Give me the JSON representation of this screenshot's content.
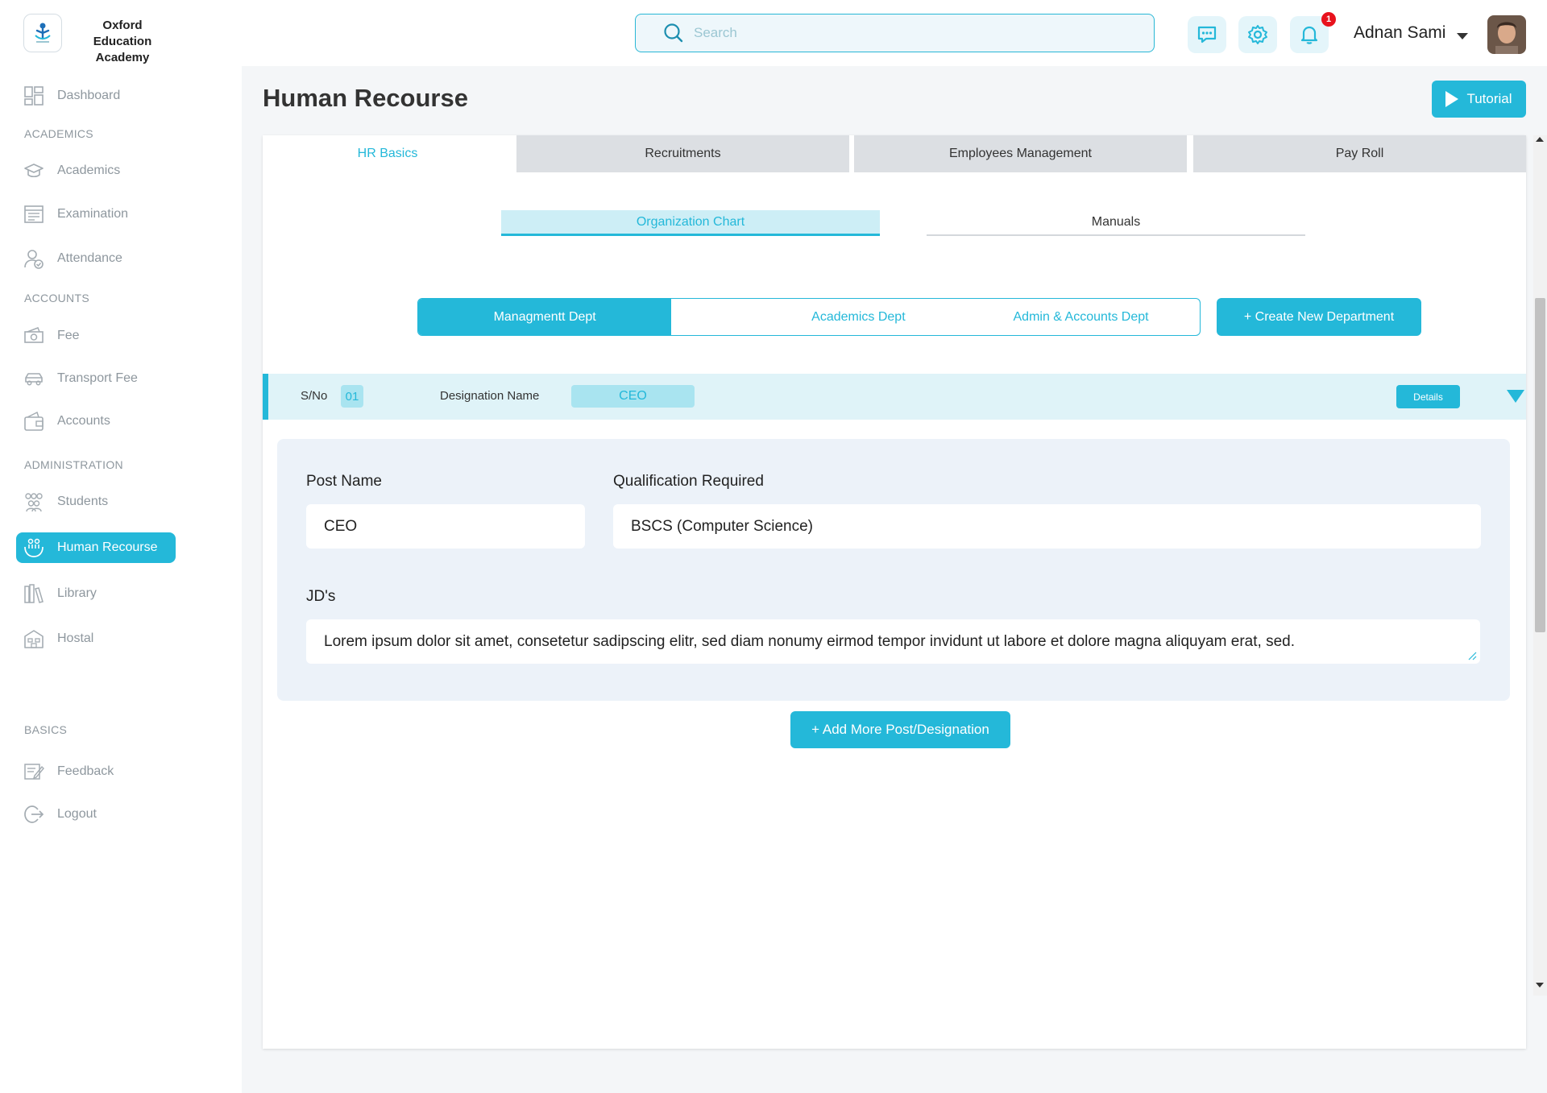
{
  "header": {
    "school_name": "Oxford Education Academy",
    "search_placeholder": "Search",
    "notification_count": "1",
    "user_name": "Adnan Sami"
  },
  "sidebar": {
    "dashboard": "Dashboard",
    "section_academics": "ACADEMICS",
    "academics": "Academics",
    "examination": "Examination",
    "attendance": "Attendance",
    "section_accounts": "ACCOUNTS",
    "fee": "Fee",
    "transport_fee": "Transport Fee",
    "accounts": "Accounts",
    "section_administration": "ADMINISTRATION",
    "students": "Students",
    "human_recourse": "Human Recourse",
    "library": "Library",
    "hostal": "Hostal",
    "section_basics": "BASICS",
    "feedback": "Feedback",
    "logout": "Logout"
  },
  "page": {
    "title": "Human Recourse",
    "tutorial_label": "Tutorial"
  },
  "tabs": {
    "hr_basics": "HR Basics",
    "recruitments": "Recruitments",
    "employees_management": "Employees Management",
    "pay_roll": "Pay Roll"
  },
  "subtabs": {
    "organization_chart": "Organization Chart",
    "manuals": "Manuals"
  },
  "departments": {
    "management": "Managmentt Dept",
    "academics": "Academics Dept",
    "admin_accounts": "Admin & Accounts Dept",
    "create_label": "+ Create New Department"
  },
  "designation_row": {
    "sno_label": "S/No",
    "sno_value": "01",
    "designation_label": "Designation Name",
    "designation_value": "CEO",
    "details_label": "Details"
  },
  "detail": {
    "post_name_label": "Post Name",
    "post_name_value": "CEO",
    "qualification_label": "Qualification Required",
    "qualification_value": "BSCS (Computer Science)",
    "jds_label": "JD's",
    "jds_value": "Lorem ipsum dolor sit amet, consetetur sadipscing elitr, sed diam nonumy eirmod tempor invidunt ut labore et dolore magna aliquyam erat, sed.",
    "add_more_label": "+ Add More Post/Designation"
  },
  "colors": {
    "accent": "#24b8d9",
    "accent_light": "#dff3f8",
    "panel": "#ecf2f9",
    "badge": "#e8121d"
  }
}
